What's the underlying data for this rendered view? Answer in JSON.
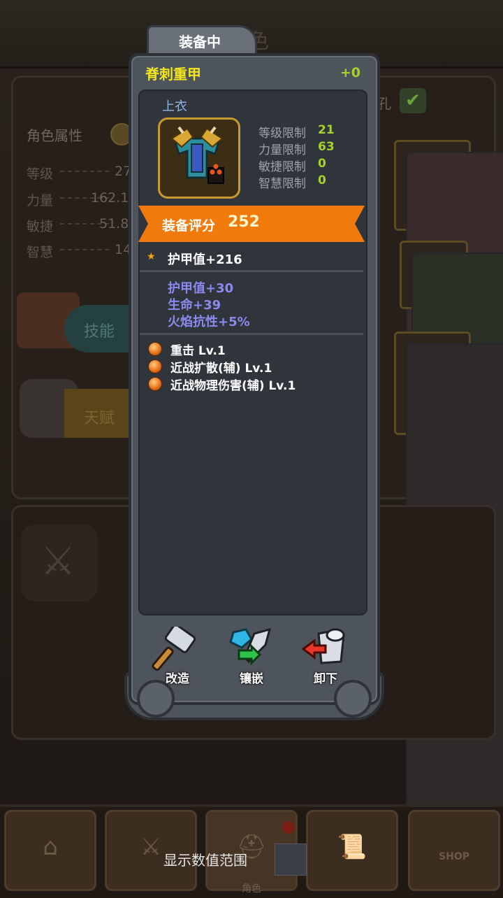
{
  "background": {
    "title_fragment": "色",
    "attributes_title": "角色属性",
    "attributes": [
      {
        "label": "等级",
        "value": "27"
      },
      {
        "label": "力量",
        "value": "162.1"
      },
      {
        "label": "敏捷",
        "value": "51.8"
      },
      {
        "label": "智慧",
        "value": "14"
      }
    ],
    "hole_label": "孔",
    "skill_button": "技能",
    "talent_button": "天赋"
  },
  "nav": {
    "tabs": [
      "home",
      "equipment",
      "role",
      "quest",
      "shop"
    ],
    "role_label": "角色",
    "shop_label": "SHOP"
  },
  "popup": {
    "tab_label": "装备中",
    "item_name": "脊刺重甲",
    "enhance_level": "+0",
    "slot": "上衣",
    "requirements": [
      {
        "label": "等级限制",
        "value": "21"
      },
      {
        "label": "力量限制",
        "value": "63"
      },
      {
        "label": "敏捷限制",
        "value": "0"
      },
      {
        "label": "智慧限制",
        "value": "0"
      }
    ],
    "score_label": "装备评分",
    "score_value": "252",
    "main_stat": "护甲值+216",
    "sub_stats": [
      "护甲值+30",
      "生命+39",
      "火焰抗性+5%"
    ],
    "skills": [
      "重击  Lv.1",
      "近战扩散(辅)  Lv.1",
      "近战物理伤害(辅)  Lv.1"
    ],
    "actions": [
      {
        "label": "改造",
        "icon": "hammer-icon"
      },
      {
        "label": "镶嵌",
        "icon": "gem-inlay-icon"
      },
      {
        "label": "卸下",
        "icon": "unequip-armor-icon"
      }
    ]
  },
  "footer": {
    "show_range_label": "显示数值范围"
  },
  "colors": {
    "item_name": "#f2e61e",
    "score_banner": "#f07a0c",
    "sub_stat": "#8a89f0",
    "requirement_value": "#a6d12d"
  }
}
